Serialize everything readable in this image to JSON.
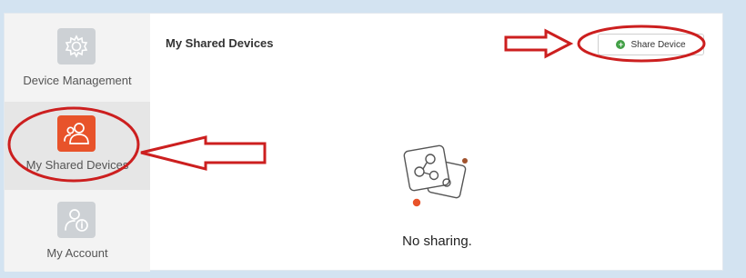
{
  "sidebar": {
    "items": [
      {
        "label": "Device Management",
        "icon": "gear-icon"
      },
      {
        "label": "My Shared Devices",
        "icon": "users-icon"
      },
      {
        "label": "My Account",
        "icon": "account-icon"
      }
    ]
  },
  "main": {
    "title": "My Shared Devices",
    "share_button": {
      "label": "Share Device",
      "icon": "plus-circle-icon"
    },
    "empty_state": {
      "text": "No sharing.",
      "icon": "share-nodes-icon"
    }
  },
  "colors": {
    "background": "#d3e3f1",
    "active_icon": "#e8532a",
    "inactive_icon": "#cdd1d5",
    "annotation": "#cc1f1f",
    "add_green": "#43a047"
  }
}
